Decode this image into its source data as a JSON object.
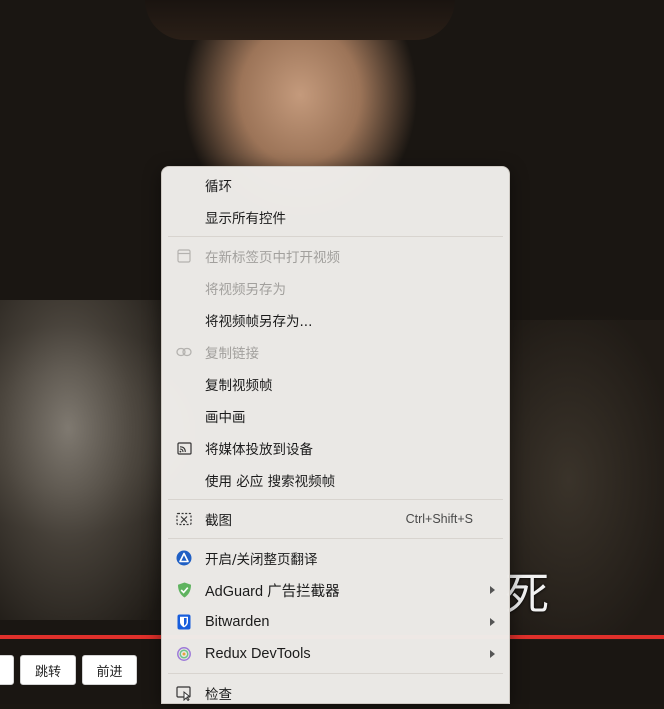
{
  "menu": {
    "items": [
      {
        "label": "循环"
      },
      {
        "label": "显示所有控件"
      },
      {
        "label": "在新标签页中打开视频",
        "icon": "new-tab-icon"
      },
      {
        "label": "将视频另存为"
      },
      {
        "label": "将视频帧另存为..."
      },
      {
        "label": "复制链接",
        "icon": "link-icon"
      },
      {
        "label": "复制视频帧"
      },
      {
        "label": "画中画"
      },
      {
        "label": "将媒体投放到设备",
        "icon": "cast-icon"
      },
      {
        "label": "使用 必应 搜索视频帧"
      },
      {
        "label": "截图",
        "icon": "screenshot-icon",
        "shortcut": "Ctrl+Shift+S"
      },
      {
        "label": "开启/关闭整页翻译",
        "icon": "translate-icon"
      },
      {
        "label": "AdGuard 广告拦截器",
        "icon": "adguard-shield-icon"
      },
      {
        "label": "Bitwarden",
        "icon": "bitwarden-shield-icon"
      },
      {
        "label": "Redux DevTools",
        "icon": "redux-icon"
      },
      {
        "label": "检查",
        "icon": "inspect-icon"
      }
    ],
    "disabled": [
      "在新标签页中打开视频",
      "将视频另存为",
      "复制链接"
    ]
  },
  "player": {
    "subtitle_glyph": "死",
    "buttons": [
      "跳转",
      "前进"
    ],
    "progress_color": "#e0302b"
  }
}
